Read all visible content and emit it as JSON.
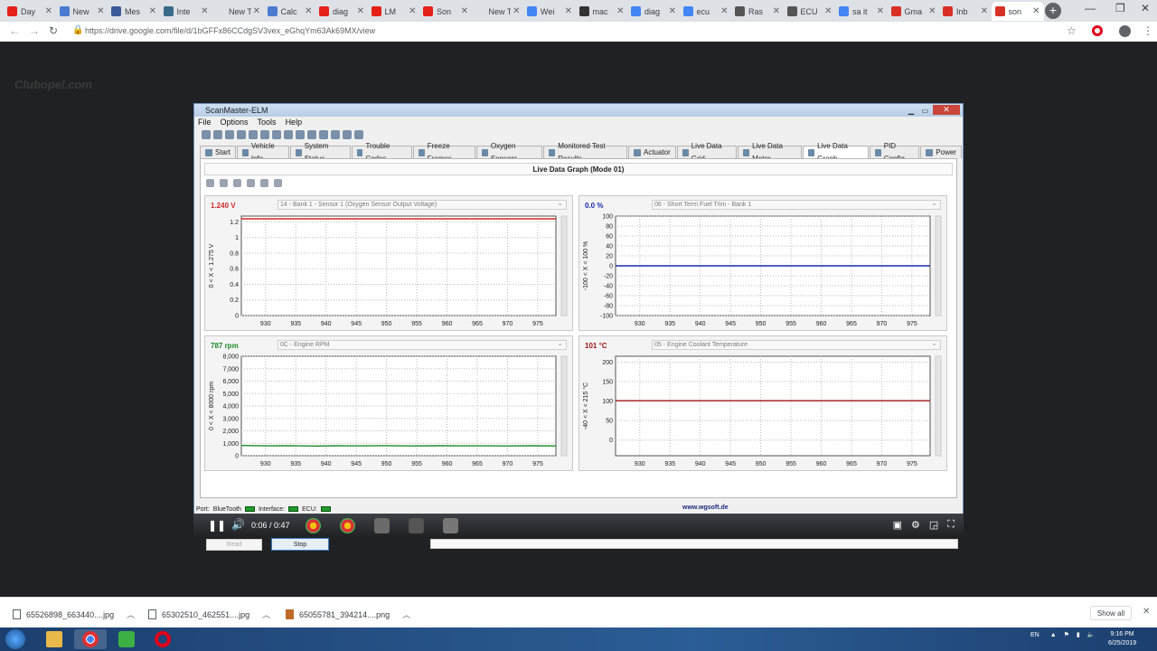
{
  "browser": {
    "tabs": [
      {
        "label": "Day",
        "color": "#e62117"
      },
      {
        "label": "New",
        "color": "#4a7bd0"
      },
      {
        "label": "Mes",
        "color": "#3b5998"
      },
      {
        "label": "Inte",
        "color": "#3a6a8a"
      },
      {
        "label": "New Tab",
        "color": ""
      },
      {
        "label": "Calc",
        "color": "#4a7bd0"
      },
      {
        "label": "diag",
        "color": "#e62117"
      },
      {
        "label": "LM",
        "color": "#e62117"
      },
      {
        "label": "Son",
        "color": "#e62117"
      },
      {
        "label": "New Tab",
        "color": ""
      },
      {
        "label": "Wei",
        "color": "#4285f4"
      },
      {
        "label": "mac",
        "color": "#333333"
      },
      {
        "label": "diag",
        "color": "#4285f4"
      },
      {
        "label": "ecu",
        "color": "#4285f4"
      },
      {
        "label": "Ras",
        "color": "#555555"
      },
      {
        "label": "ECU",
        "color": "#555555"
      },
      {
        "label": "sa it",
        "color": "#4285f4"
      },
      {
        "label": "Gma",
        "color": "#d93025"
      },
      {
        "label": "Inb",
        "color": "#d93025"
      },
      {
        "label": "son",
        "color": "#d93025"
      }
    ],
    "url": "https://drive.google.com/file/d/1bGFFx86CCdgSV3vex_eGhqYm63Ak69MX/view",
    "watermark": "Clubopel.com"
  },
  "scanmaster": {
    "title": "ScanMaster-ELM",
    "menu": [
      "File",
      "Options",
      "Tools",
      "Help"
    ],
    "tabs": [
      {
        "label": "Start"
      },
      {
        "label": "Vehicle Info"
      },
      {
        "label": "System Status"
      },
      {
        "label": "Trouble Codes"
      },
      {
        "label": "Freeze Frames"
      },
      {
        "label": "Oxygen Sensors"
      },
      {
        "label": "Monitored Test Results"
      },
      {
        "label": "Actuator"
      },
      {
        "label": "Live Data Grid"
      },
      {
        "label": "Live Data Meter"
      },
      {
        "label": "Live Data Graph",
        "active": true
      },
      {
        "label": "PID Config"
      },
      {
        "label": "Power"
      }
    ],
    "panel_title": "Live Data Graph (Mode 01)",
    "buttons": {
      "read": "Read",
      "stop": "Stop"
    },
    "status": {
      "port": "Port:",
      "port_value": "BlueTooth",
      "interface": "Interface:",
      "ecu": "ECU:",
      "website": "www.wgsoft.de"
    }
  },
  "chart_data": [
    {
      "type": "line",
      "current_value": "1.240 V",
      "value_color": "#d0282a",
      "pid_select": "14 - Bank 1 - Sensor 1 (Oxygen Sensor Output Voltage)",
      "ylabel": "0  < X <  1.275  V",
      "yticks": [
        "0",
        "0.2",
        "0.4",
        "0.6",
        "0.8",
        "1",
        "1.2"
      ],
      "ylim": [
        0,
        1.275
      ],
      "xticks": [
        "930",
        "935",
        "940",
        "945",
        "950",
        "955",
        "960",
        "965",
        "970",
        "975"
      ],
      "xlim": [
        926,
        978
      ],
      "series": [
        {
          "color": "#d0282a",
          "x": [
            926,
            978
          ],
          "y": [
            1.24,
            1.24
          ]
        }
      ]
    },
    {
      "type": "line",
      "current_value": "0.0 %",
      "value_color": "#1a2ab0",
      "pid_select": "06 - Short Term Fuel Trim - Bank 1",
      "ylabel": "-100  < X <  100  %",
      "yticks": [
        "-100",
        "-80",
        "-60",
        "-40",
        "-20",
        "0",
        "20",
        "40",
        "60",
        "80",
        "100"
      ],
      "ylim": [
        -100,
        100
      ],
      "xticks": [
        "930",
        "935",
        "940",
        "945",
        "950",
        "955",
        "960",
        "965",
        "970",
        "975"
      ],
      "xlim": [
        926,
        978
      ],
      "series": [
        {
          "color": "#1a2ab0",
          "x": [
            926,
            978
          ],
          "y": [
            0,
            0
          ]
        }
      ]
    },
    {
      "type": "line",
      "current_value": "787 rpm",
      "value_color": "#1e8a2a",
      "pid_select": "0C - Engine RPM",
      "ylabel": "0  < X <  8000  rpm",
      "yticks": [
        "0",
        "1,000",
        "2,000",
        "3,000",
        "4,000",
        "5,000",
        "6,000",
        "7,000",
        "8,000"
      ],
      "ylim": [
        0,
        8000
      ],
      "xticks": [
        "930",
        "935",
        "940",
        "945",
        "950",
        "955",
        "960",
        "965",
        "970",
        "975"
      ],
      "xlim": [
        926,
        978
      ],
      "series": [
        {
          "color": "#1e8a2a",
          "x": [
            926,
            930,
            934,
            938,
            942,
            946,
            950,
            954,
            958,
            962,
            966,
            970,
            974,
            978
          ],
          "y": [
            820,
            790,
            810,
            780,
            800,
            790,
            805,
            785,
            800,
            790,
            795,
            785,
            800,
            787
          ]
        }
      ]
    },
    {
      "type": "line",
      "current_value": "101 °C",
      "value_color": "#a01818",
      "pid_select": "05 - Engine Coolant Temperature",
      "ylabel": "-40  < X <  215  °C",
      "yticks": [
        "0",
        "50",
        "100",
        "150",
        "200"
      ],
      "ylim": [
        -40,
        215
      ],
      "xticks": [
        "930",
        "935",
        "940",
        "945",
        "950",
        "955",
        "960",
        "965",
        "970",
        "975"
      ],
      "xlim": [
        926,
        978
      ],
      "series": [
        {
          "color": "#a01818",
          "x": [
            926,
            978
          ],
          "y": [
            101,
            101
          ]
        }
      ]
    }
  ],
  "video": {
    "time": "0:06 / 0:47"
  },
  "downloads": [
    {
      "name": "65526898_663440....jpg"
    },
    {
      "name": "65302510_462551....jpg"
    },
    {
      "name": "65055781_394214....png"
    }
  ],
  "downloads_show_all": "Show all",
  "taskbar": {
    "lang": "EN",
    "time": "9:16 PM",
    "date": "6/25/2019"
  }
}
